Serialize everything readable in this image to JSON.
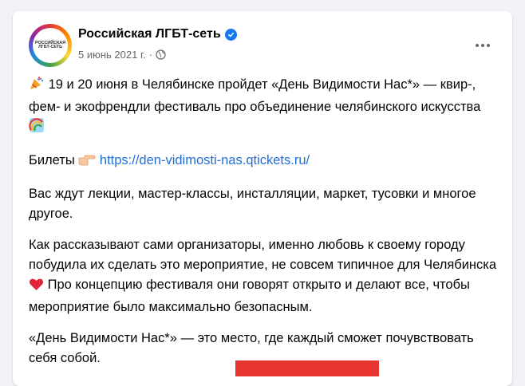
{
  "post": {
    "author": "Российская ЛГБТ-сеть",
    "avatar_text": [
      "РОССИЙСКАЯ",
      "ЛГБТ-СЕТЬ"
    ],
    "date": "5 июнь 2021 г.",
    "separator": "·",
    "icons": {
      "verified": "verified-badge-icon",
      "audience": "globe-icon",
      "more": "more-dots-icon"
    },
    "paragraphs": {
      "p1": "19 и 20 июня в Челябинске пройдет «День Видимости Нас*» — квир-, фем- и экофрендли фестиваль про объединение челябинского искусства",
      "p2_label": "Билеты",
      "p2_link": "https://den-vidimosti-nas.qtickets.ru/",
      "p3": "Вас ждут лекции, мастер-классы, инсталляции, маркет, тусовки и многое другое.",
      "p4a": "Как рассказывают сами организаторы, именно любовь к своему городу побудила их сделать это мероприятие, не совсем типичное для Челябинска",
      "p4b": "Про концепцию фестиваля они говорят открыто и делают все, чтобы мероприятие было максимально безопасным.",
      "p5": "«День Видимости Нас*» — это место, где каждый сможет почувствовать себя собой."
    },
    "emojis": {
      "party": "party-popper-icon",
      "rainbow": "rainbow-icon",
      "pointer": "pointing-right-icon",
      "heart": "red-heart-icon"
    },
    "colors": {
      "link": "#216fdb",
      "verified": "#1877f2",
      "secondary_text": "#65676b"
    }
  }
}
